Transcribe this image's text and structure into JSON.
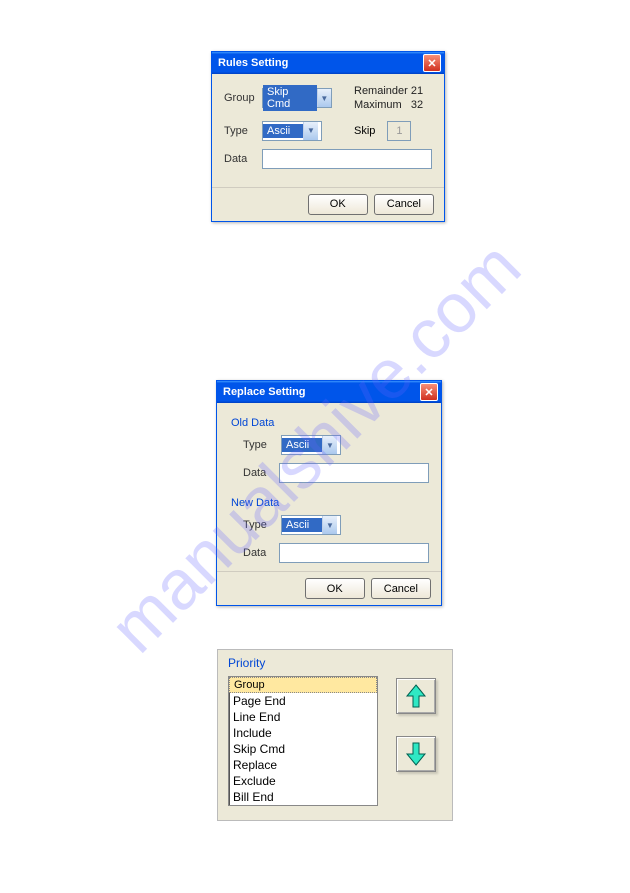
{
  "watermark": "manualshive.com",
  "rules_dialog": {
    "title": "Rules Setting",
    "group_label": "Group",
    "group_value": "Skip Cmd",
    "type_label": "Type",
    "type_value": "Ascii",
    "data_label": "Data",
    "data_value": "",
    "remainder_label": "Remainder",
    "remainder_value": "21",
    "maximum_label": "Maximum",
    "maximum_value": "32",
    "skip_label": "Skip",
    "skip_value": "1",
    "ok": "OK",
    "cancel": "Cancel"
  },
  "replace_dialog": {
    "title": "Replace Setting",
    "old_data": "Old Data",
    "new_data": "New Data",
    "type_label": "Type",
    "type_value_old": "Ascii",
    "type_value_new": "Ascii",
    "data_label": "Data",
    "data_value_old": "",
    "data_value_new": "",
    "ok": "OK",
    "cancel": "Cancel"
  },
  "priority": {
    "title": "Priority",
    "items": [
      "Group",
      "Page End",
      "Line End",
      "Include",
      "Skip Cmd",
      "Replace",
      "Exclude",
      "Bill End"
    ],
    "selected_index": 0
  }
}
